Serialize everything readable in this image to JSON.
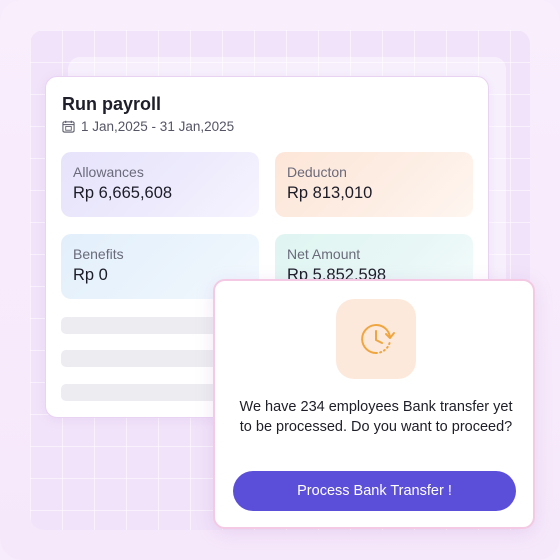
{
  "payroll": {
    "title": "Run payroll",
    "date_range": "1 Jan,2025 - 31 Jan,2025",
    "date_icon": "calendar-icon"
  },
  "summary": {
    "allowances": {
      "label": "Allowances",
      "value": "Rp 6,665,608"
    },
    "deduction": {
      "label": "Deducton",
      "value": "Rp 813,010"
    },
    "benefits": {
      "label": "Benefits",
      "value": "Rp 0"
    },
    "net_amount": {
      "label": "Net Amount",
      "value": "Rp 5,852,598"
    }
  },
  "dialog": {
    "icon": "clock-refresh-icon",
    "message": "We have 234 employees Bank transfer yet to be processed. Do you want to proceed?",
    "button_label": "Process Bank Transfer !"
  },
  "colors": {
    "accent": "#5b4fd9",
    "icon_orange": "#f0a640",
    "icon_bg": "#fde9dc"
  }
}
